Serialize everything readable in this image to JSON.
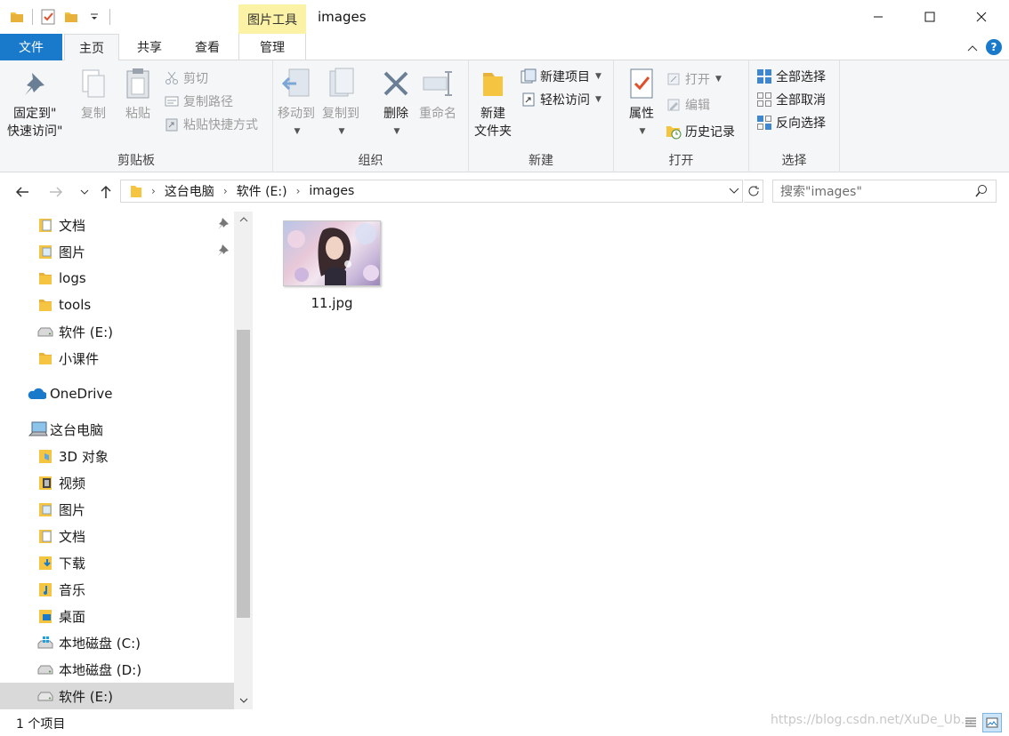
{
  "titlebar": {
    "title": "images",
    "context_tab_header": "图片工具"
  },
  "ribbon_tabs": {
    "file": "文件",
    "home": "主页",
    "share": "共享",
    "view": "查看",
    "manage": "管理"
  },
  "help_glyph": "?",
  "clipboard": {
    "pin_line1": "固定到\"",
    "pin_line2": "快速访问\"",
    "copy": "复制",
    "paste": "粘贴",
    "cut": "剪切",
    "copy_path": "复制路径",
    "paste_shortcut": "粘贴快捷方式",
    "label": "剪贴板"
  },
  "organize": {
    "move_to": "移动到",
    "copy_to": "复制到",
    "delete": "删除",
    "rename": "重命名",
    "label": "组织"
  },
  "new_group": {
    "new_folder_line1": "新建",
    "new_folder_line2": "文件夹",
    "new_item": "新建项目",
    "easy_access": "轻松访问",
    "label": "新建"
  },
  "open_group": {
    "properties": "属性",
    "open": "打开",
    "edit": "编辑",
    "history": "历史记录",
    "label": "打开"
  },
  "select_group": {
    "select_all": "全部选择",
    "select_none": "全部取消",
    "invert": "反向选择",
    "label": "选择"
  },
  "address": {
    "crumbs": [
      "这台电脑",
      "软件 (E:)",
      "images"
    ],
    "search_placeholder": "搜索\"images\""
  },
  "nav_pane": {
    "items": [
      {
        "label": "文档",
        "icon": "documents-folder-icon",
        "pinned": true
      },
      {
        "label": "图片",
        "icon": "pictures-folder-icon",
        "pinned": true
      },
      {
        "label": "logs",
        "icon": "folder-icon"
      },
      {
        "label": "tools",
        "icon": "folder-icon"
      },
      {
        "label": "软件 (E:)",
        "icon": "drive-icon"
      },
      {
        "label": "小课件",
        "icon": "folder-icon"
      },
      {
        "label": "OneDrive",
        "icon": "onedrive-cloud-icon"
      },
      {
        "label": "这台电脑",
        "icon": "this-pc-icon"
      },
      {
        "label": "3D 对象",
        "icon": "3d-objects-folder-icon"
      },
      {
        "label": "视频",
        "icon": "videos-folder-icon"
      },
      {
        "label": "图片",
        "icon": "pictures-folder-icon"
      },
      {
        "label": "文档",
        "icon": "documents-folder-icon"
      },
      {
        "label": "下载",
        "icon": "downloads-folder-icon"
      },
      {
        "label": "音乐",
        "icon": "music-folder-icon"
      },
      {
        "label": "桌面",
        "icon": "desktop-folder-icon"
      },
      {
        "label": "本地磁盘 (C:)",
        "icon": "windows-drive-icon"
      },
      {
        "label": "本地磁盘 (D:)",
        "icon": "drive-icon"
      },
      {
        "label": "软件 (E:)",
        "icon": "drive-icon",
        "selected": true
      }
    ]
  },
  "files": [
    {
      "name": "11.jpg",
      "type": "image-thumbnail"
    }
  ],
  "status": {
    "count": "1 个项目",
    "watermark": "https://blog.csdn.net/XuDe_Ub..."
  },
  "colors": {
    "accent": "#1979ca",
    "context_tab": "#fcf2a5",
    "ribbon_bg": "#f5f6f7",
    "folder": "#f5c542",
    "selected_row": "#d9d9d9"
  }
}
